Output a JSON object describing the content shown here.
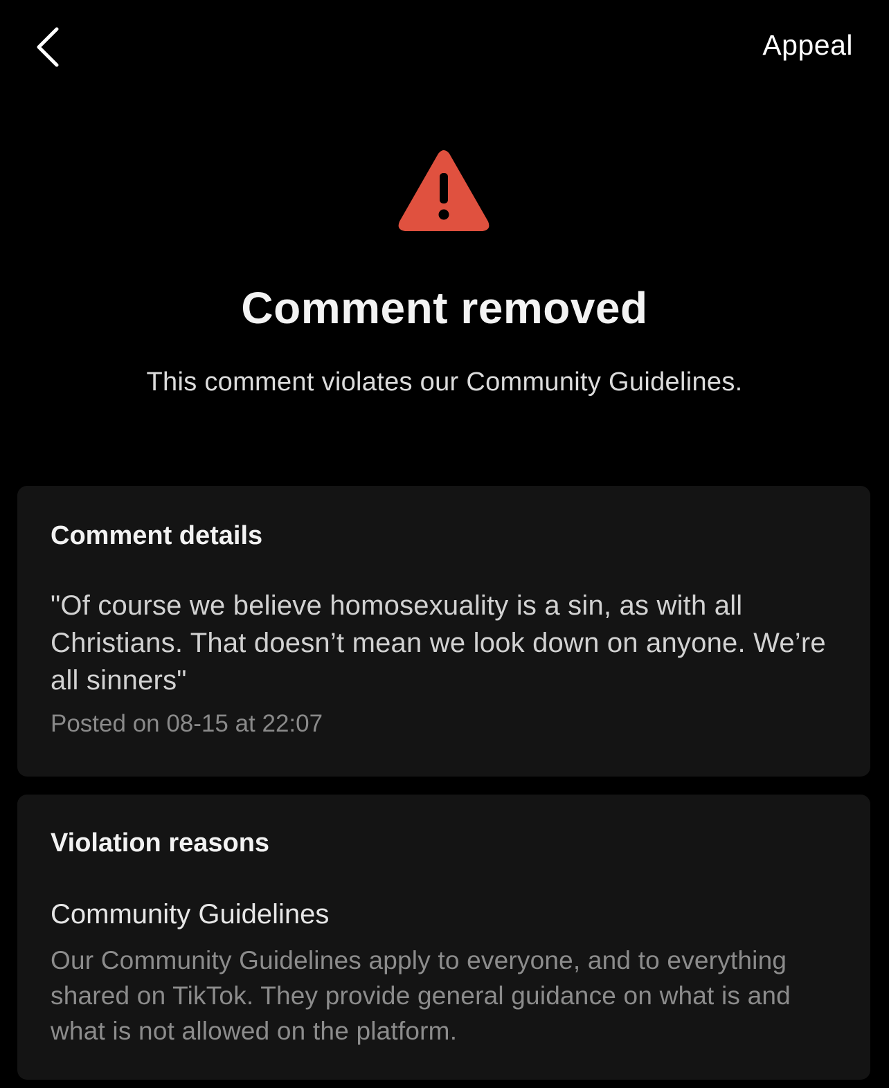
{
  "header": {
    "back_icon": "chevron-left-icon",
    "appeal_label": "Appeal"
  },
  "status": {
    "icon": "warning-triangle-icon",
    "icon_color": "#e0513f",
    "title": "Comment removed",
    "subtitle": "This comment violates our Community Guidelines."
  },
  "comment_details": {
    "heading": "Comment details",
    "text": "\"Of course we believe homosexuality is a sin, as with all Christians. That doesn’t mean we look down on anyone. We’re all sinners\"",
    "posted": "Posted on 08-15 at 22:07"
  },
  "violation": {
    "heading": "Violation reasons",
    "reason_title": "Community Guidelines",
    "reason_description": "Our Community Guidelines apply to everyone, and to everything shared on TikTok. They provide general guidance on what is and what is not allowed on the platform."
  },
  "colors": {
    "background": "#000000",
    "card": "#141414",
    "primary_text": "#f3f3f3",
    "secondary_text": "#8a8a8a",
    "warning": "#e0513f"
  }
}
